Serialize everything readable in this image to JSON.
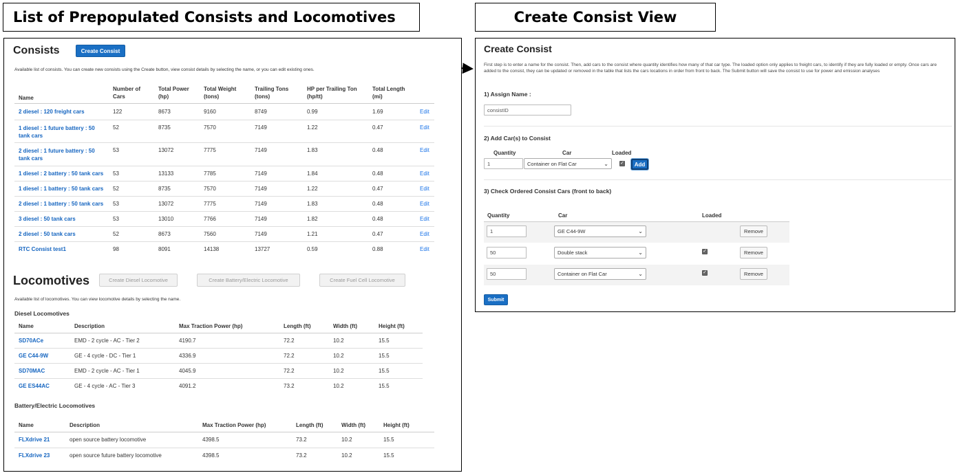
{
  "captions": {
    "left": "List of Prepopulated Consists and Locomotives",
    "right": "Create Consist View"
  },
  "consists": {
    "title": "Consists",
    "create_button": "Create Consist",
    "description": "Available list of consists. You can create new consists using the Create button, view consist details by selecting the name, or you can edit existing ones.",
    "headers": [
      "Name",
      "Number of Cars",
      "Total Power (hp)",
      "Total Weight (tons)",
      "Trailing Tons (tons)",
      "HP per Trailing Ton (hp/tt)",
      "Total Length (mi)"
    ],
    "edit_label": "Edit",
    "rows": [
      {
        "name": "2 diesel : 120 freight cars",
        "cars": "122",
        "power": "8673",
        "weight": "9160",
        "trailing": "8749",
        "hppt": "0.99",
        "length": "1.69"
      },
      {
        "name": "1 diesel : 1 future battery : 50 tank cars",
        "cars": "52",
        "power": "8735",
        "weight": "7570",
        "trailing": "7149",
        "hppt": "1.22",
        "length": "0.47"
      },
      {
        "name": "2 diesel : 1 future battery : 50 tank cars",
        "cars": "53",
        "power": "13072",
        "weight": "7775",
        "trailing": "7149",
        "hppt": "1.83",
        "length": "0.48"
      },
      {
        "name": "1 diesel : 2 battery : 50 tank cars",
        "cars": "53",
        "power": "13133",
        "weight": "7785",
        "trailing": "7149",
        "hppt": "1.84",
        "length": "0.48"
      },
      {
        "name": "1 diesel : 1 battery : 50 tank cars",
        "cars": "52",
        "power": "8735",
        "weight": "7570",
        "trailing": "7149",
        "hppt": "1.22",
        "length": "0.47"
      },
      {
        "name": "2 diesel : 1 battery : 50 tank cars",
        "cars": "53",
        "power": "13072",
        "weight": "7775",
        "trailing": "7149",
        "hppt": "1.83",
        "length": "0.48"
      },
      {
        "name": "3 diesel : 50 tank cars",
        "cars": "53",
        "power": "13010",
        "weight": "7766",
        "trailing": "7149",
        "hppt": "1.82",
        "length": "0.48"
      },
      {
        "name": "2 diesel : 50 tank cars",
        "cars": "52",
        "power": "8673",
        "weight": "7560",
        "trailing": "7149",
        "hppt": "1.21",
        "length": "0.47"
      },
      {
        "name": "RTC Consist test1",
        "cars": "98",
        "power": "8091",
        "weight": "14138",
        "trailing": "13727",
        "hppt": "0.59",
        "length": "0.88"
      }
    ]
  },
  "locomotives": {
    "title": "Locomotives",
    "buttons": [
      "Create Diesel Locomotive",
      "Create Battery/Electric Locomotive",
      "Create Fuel Cell Locomotive"
    ],
    "description": "Available list of locomotives. You can view locomotive details by selecting the name.",
    "diesel": {
      "title": "Diesel Locomotives",
      "headers": [
        "Name",
        "Description",
        "Max Traction Power (hp)",
        "Length (ft)",
        "Width (ft)",
        "Height (ft)"
      ],
      "rows": [
        {
          "name": "SD70ACe",
          "desc": "EMD - 2 cycle - AC - Tier 2",
          "power": "4190.7",
          "length": "72.2",
          "width": "10.2",
          "height": "15.5"
        },
        {
          "name": "GE C44-9W",
          "desc": "GE - 4 cycle - DC - Tier 1",
          "power": "4336.9",
          "length": "72.2",
          "width": "10.2",
          "height": "15.5"
        },
        {
          "name": "SD70MAC",
          "desc": "EMD - 2 cycle - AC - Tier 1",
          "power": "4045.9",
          "length": "72.2",
          "width": "10.2",
          "height": "15.5"
        },
        {
          "name": "GE ES44AC",
          "desc": "GE - 4 cycle - AC - Tier 3",
          "power": "4091.2",
          "length": "73.2",
          "width": "10.2",
          "height": "15.5"
        }
      ]
    },
    "battery": {
      "title": "Battery/Electric Locomotives",
      "headers": [
        "Name",
        "Description",
        "Max Traction Power (hp)",
        "Length (ft)",
        "Width (ft)",
        "Height (ft)"
      ],
      "rows": [
        {
          "name": "FLXdrive 21",
          "desc": "open source battery locomotive",
          "power": "4398.5",
          "length": "73.2",
          "width": "10.2",
          "height": "15.5"
        },
        {
          "name": "FLXdrive 23",
          "desc": "open source future battery locomotive",
          "power": "4398.5",
          "length": "73.2",
          "width": "10.2",
          "height": "15.5"
        }
      ]
    }
  },
  "create_view": {
    "title": "Create Consist",
    "description": "First step is to enter a name for the consist. Then, add cars to the consist where quantity identifies how many of that car type. The loaded option only applies to freight cars, to identify if they are fully loaded or empty. Once cars are added to the consist, they can be updated or removed in the table that lists the cars locations in order from front to back. The Submit button will save the consist to use for power and emission analyses",
    "step1": "1) Assign Name :",
    "name_placeholder": "consistID",
    "step2": "2) Add Car(s) to Consist",
    "add_headers": {
      "quantity": "Quantity",
      "car": "Car",
      "loaded": "Loaded"
    },
    "add_quantity": "1",
    "add_car": "Container on Flat Car",
    "add_button": "Add",
    "step3": "3) Check Ordered Consist Cars (front to back)",
    "table_headers": {
      "quantity": "Quantity",
      "car": "Car",
      "loaded": "Loaded"
    },
    "ordered": [
      {
        "quantity": "1",
        "car": "GE C44-9W",
        "loaded": false
      },
      {
        "quantity": "50",
        "car": "Double stack",
        "loaded": true
      },
      {
        "quantity": "50",
        "car": "Container on Flat Car",
        "loaded": true
      }
    ],
    "remove_label": "Remove",
    "submit_label": "Submit"
  }
}
